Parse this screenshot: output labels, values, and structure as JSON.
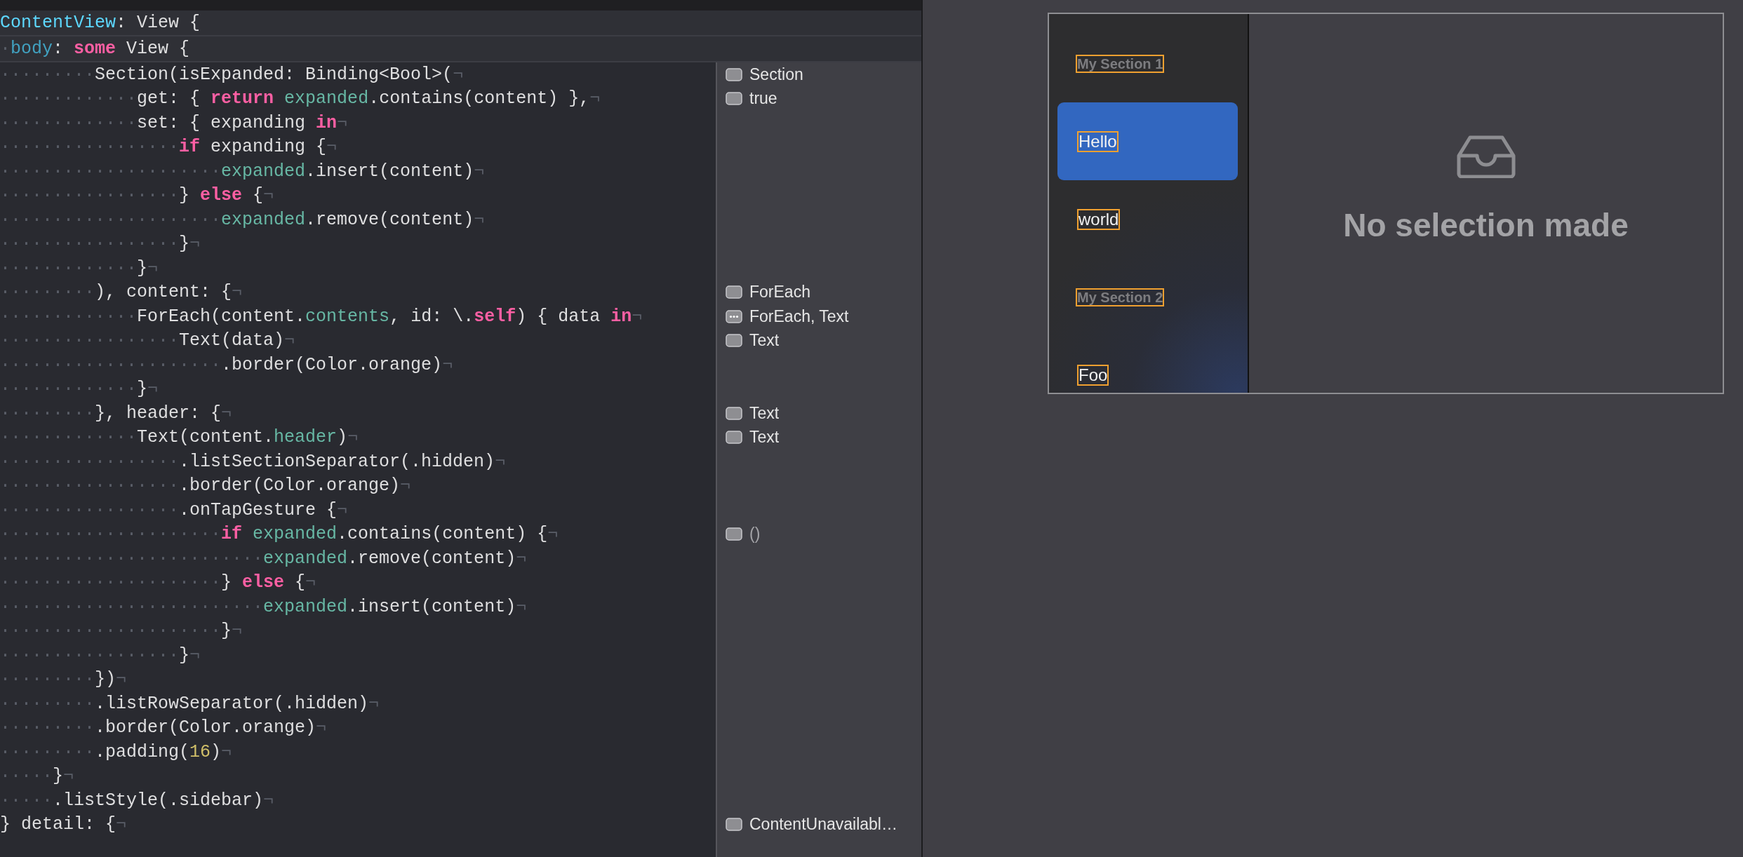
{
  "sticky_headers": [
    [
      {
        "kind": "decl",
        "text": "ContentView"
      },
      {
        "kind": "plain",
        "text": ": View {"
      }
    ],
    [
      {
        "kind": "ws",
        "text": "·"
      },
      {
        "kind": "prop",
        "text": "body"
      },
      {
        "kind": "plain",
        "text": ": "
      },
      {
        "kind": "keyword",
        "text": "some"
      },
      {
        "kind": "plain",
        "text": " View {"
      }
    ]
  ],
  "code_lines": [
    {
      "tokens": [
        {
          "kind": "ws",
          "text": "·········"
        },
        {
          "kind": "plain",
          "text": "Section(isExpanded: Binding<Bool>("
        },
        {
          "kind": "invis",
          "text": "¬"
        }
      ],
      "note": {
        "text": "Section",
        "kind": "view",
        "dimmed": false
      }
    },
    {
      "tokens": [
        {
          "kind": "ws",
          "text": "·············"
        },
        {
          "kind": "plain",
          "text": "get: { "
        },
        {
          "kind": "keyword",
          "text": "return "
        },
        {
          "kind": "member",
          "text": "expanded"
        },
        {
          "kind": "plain",
          "text": ".contains(content) },"
        },
        {
          "kind": "invis",
          "text": "¬"
        }
      ],
      "note": {
        "text": "true",
        "kind": "view",
        "dimmed": false
      }
    },
    {
      "tokens": [
        {
          "kind": "ws",
          "text": "·············"
        },
        {
          "kind": "plain",
          "text": "set: { expanding "
        },
        {
          "kind": "keyword",
          "text": "in"
        },
        {
          "kind": "invis",
          "text": "¬"
        }
      ]
    },
    {
      "tokens": [
        {
          "kind": "ws",
          "text": "·················"
        },
        {
          "kind": "keyword",
          "text": "if"
        },
        {
          "kind": "plain",
          "text": " expanding {"
        },
        {
          "kind": "invis",
          "text": "¬"
        }
      ]
    },
    {
      "tokens": [
        {
          "kind": "ws",
          "text": "·····················"
        },
        {
          "kind": "member",
          "text": "expanded"
        },
        {
          "kind": "plain",
          "text": ".insert(content)"
        },
        {
          "kind": "invis",
          "text": "¬"
        }
      ]
    },
    {
      "tokens": [
        {
          "kind": "ws",
          "text": "·················"
        },
        {
          "kind": "plain",
          "text": "} "
        },
        {
          "kind": "keyword",
          "text": "else"
        },
        {
          "kind": "plain",
          "text": " {"
        },
        {
          "kind": "invis",
          "text": "¬"
        }
      ]
    },
    {
      "tokens": [
        {
          "kind": "ws",
          "text": "·····················"
        },
        {
          "kind": "member",
          "text": "expanded"
        },
        {
          "kind": "plain",
          "text": ".remove(content)"
        },
        {
          "kind": "invis",
          "text": "¬"
        }
      ]
    },
    {
      "tokens": [
        {
          "kind": "ws",
          "text": "·················"
        },
        {
          "kind": "plain",
          "text": "}"
        },
        {
          "kind": "invis",
          "text": "¬"
        }
      ]
    },
    {
      "tokens": [
        {
          "kind": "ws",
          "text": "·············"
        },
        {
          "kind": "plain",
          "text": "}"
        },
        {
          "kind": "invis",
          "text": "¬"
        }
      ]
    },
    {
      "tokens": [
        {
          "kind": "ws",
          "text": "·········"
        },
        {
          "kind": "plain",
          "text": "), content: {"
        },
        {
          "kind": "invis",
          "text": "¬"
        }
      ],
      "note": {
        "text": "ForEach",
        "kind": "view",
        "dimmed": false
      }
    },
    {
      "tokens": [
        {
          "kind": "ws",
          "text": "·············"
        },
        {
          "kind": "plain",
          "text": "ForEach(content."
        },
        {
          "kind": "member",
          "text": "contents"
        },
        {
          "kind": "plain",
          "text": ", id: \\."
        },
        {
          "kind": "keyword",
          "text": "self"
        },
        {
          "kind": "plain",
          "text": ") { data "
        },
        {
          "kind": "keyword",
          "text": "in"
        },
        {
          "kind": "invis",
          "text": "¬"
        }
      ],
      "note": {
        "text": "ForEach, Text",
        "kind": "multi",
        "dimmed": false
      }
    },
    {
      "tokens": [
        {
          "kind": "ws",
          "text": "·················"
        },
        {
          "kind": "plain",
          "text": "Text(data)"
        },
        {
          "kind": "invis",
          "text": "¬"
        }
      ],
      "note": {
        "text": "Text",
        "kind": "view",
        "dimmed": false
      }
    },
    {
      "tokens": [
        {
          "kind": "ws",
          "text": "·····················"
        },
        {
          "kind": "plain",
          "text": ".border(Color.orange)"
        },
        {
          "kind": "invis",
          "text": "¬"
        }
      ]
    },
    {
      "tokens": [
        {
          "kind": "ws",
          "text": "·············"
        },
        {
          "kind": "plain",
          "text": "}"
        },
        {
          "kind": "invis",
          "text": "¬"
        }
      ]
    },
    {
      "tokens": [
        {
          "kind": "ws",
          "text": "·········"
        },
        {
          "kind": "plain",
          "text": "}, header: {"
        },
        {
          "kind": "invis",
          "text": "¬"
        }
      ],
      "note": {
        "text": "Text",
        "kind": "view",
        "dimmed": false
      }
    },
    {
      "tokens": [
        {
          "kind": "ws",
          "text": "·············"
        },
        {
          "kind": "plain",
          "text": "Text(content."
        },
        {
          "kind": "member",
          "text": "header"
        },
        {
          "kind": "plain",
          "text": ")"
        },
        {
          "kind": "invis",
          "text": "¬"
        }
      ],
      "note": {
        "text": "Text",
        "kind": "view",
        "dimmed": false
      }
    },
    {
      "tokens": [
        {
          "kind": "ws",
          "text": "·················"
        },
        {
          "kind": "plain",
          "text": ".listSectionSeparator(.hidden)"
        },
        {
          "kind": "invis",
          "text": "¬"
        }
      ]
    },
    {
      "tokens": [
        {
          "kind": "ws",
          "text": "·················"
        },
        {
          "kind": "plain",
          "text": ".border(Color.orange)"
        },
        {
          "kind": "invis",
          "text": "¬"
        }
      ]
    },
    {
      "tokens": [
        {
          "kind": "ws",
          "text": "·················"
        },
        {
          "kind": "plain",
          "text": ".onTapGesture {"
        },
        {
          "kind": "invis",
          "text": "¬"
        }
      ]
    },
    {
      "tokens": [
        {
          "kind": "ws",
          "text": "·····················"
        },
        {
          "kind": "keyword",
          "text": "if "
        },
        {
          "kind": "member",
          "text": "expanded"
        },
        {
          "kind": "plain",
          "text": ".contains(content) {"
        },
        {
          "kind": "invis",
          "text": "¬"
        }
      ],
      "note": {
        "text": "()",
        "kind": "view",
        "dimmed": true
      }
    },
    {
      "tokens": [
        {
          "kind": "ws",
          "text": "·························"
        },
        {
          "kind": "member",
          "text": "expanded"
        },
        {
          "kind": "plain",
          "text": ".remove(content)"
        },
        {
          "kind": "invis",
          "text": "¬"
        }
      ]
    },
    {
      "tokens": [
        {
          "kind": "ws",
          "text": "·····················"
        },
        {
          "kind": "plain",
          "text": "} "
        },
        {
          "kind": "keyword",
          "text": "else"
        },
        {
          "kind": "plain",
          "text": " {"
        },
        {
          "kind": "invis",
          "text": "¬"
        }
      ]
    },
    {
      "tokens": [
        {
          "kind": "ws",
          "text": "·························"
        },
        {
          "kind": "member",
          "text": "expanded"
        },
        {
          "kind": "plain",
          "text": ".insert(content)"
        },
        {
          "kind": "invis",
          "text": "¬"
        }
      ]
    },
    {
      "tokens": [
        {
          "kind": "ws",
          "text": "·····················"
        },
        {
          "kind": "plain",
          "text": "}"
        },
        {
          "kind": "invis",
          "text": "¬"
        }
      ]
    },
    {
      "tokens": [
        {
          "kind": "ws",
          "text": "·················"
        },
        {
          "kind": "plain",
          "text": "}"
        },
        {
          "kind": "invis",
          "text": "¬"
        }
      ]
    },
    {
      "tokens": [
        {
          "kind": "ws",
          "text": "·········"
        },
        {
          "kind": "plain",
          "text": "})"
        },
        {
          "kind": "invis",
          "text": "¬"
        }
      ]
    },
    {
      "tokens": [
        {
          "kind": "ws",
          "text": "·········"
        },
        {
          "kind": "plain",
          "text": ".listRowSeparator(.hidden)"
        },
        {
          "kind": "invis",
          "text": "¬"
        }
      ]
    },
    {
      "tokens": [
        {
          "kind": "ws",
          "text": "·········"
        },
        {
          "kind": "plain",
          "text": ".border(Color.orange)"
        },
        {
          "kind": "invis",
          "text": "¬"
        }
      ]
    },
    {
      "tokens": [
        {
          "kind": "ws",
          "text": "·········"
        },
        {
          "kind": "plain",
          "text": ".padding("
        },
        {
          "kind": "number",
          "text": "16"
        },
        {
          "kind": "plain",
          "text": ")"
        },
        {
          "kind": "invis",
          "text": "¬"
        }
      ]
    },
    {
      "tokens": [
        {
          "kind": "ws",
          "text": "·····"
        },
        {
          "kind": "plain",
          "text": "}"
        },
        {
          "kind": "invis",
          "text": "¬"
        }
      ]
    },
    {
      "tokens": [
        {
          "kind": "ws",
          "text": "·····"
        },
        {
          "kind": "plain",
          "text": ".listStyle(.sidebar)"
        },
        {
          "kind": "invis",
          "text": "¬"
        }
      ]
    },
    {
      "tokens": [
        {
          "kind": "plain",
          "text": "} detail: {"
        },
        {
          "kind": "invis",
          "text": "¬"
        }
      ],
      "note": {
        "text": "ContentUnavailabl…",
        "kind": "view",
        "dimmed": false
      }
    }
  ],
  "preview": {
    "sidebar": [
      {
        "kind": "header",
        "text": "My Section 1",
        "selected": false
      },
      {
        "kind": "row",
        "text": "Hello",
        "selected": true
      },
      {
        "kind": "row",
        "text": "world",
        "selected": false
      },
      {
        "kind": "header",
        "text": "My Section 2",
        "selected": false
      },
      {
        "kind": "row",
        "text": "Foo",
        "selected": false
      }
    ],
    "detail": {
      "message": "No selection made"
    }
  }
}
